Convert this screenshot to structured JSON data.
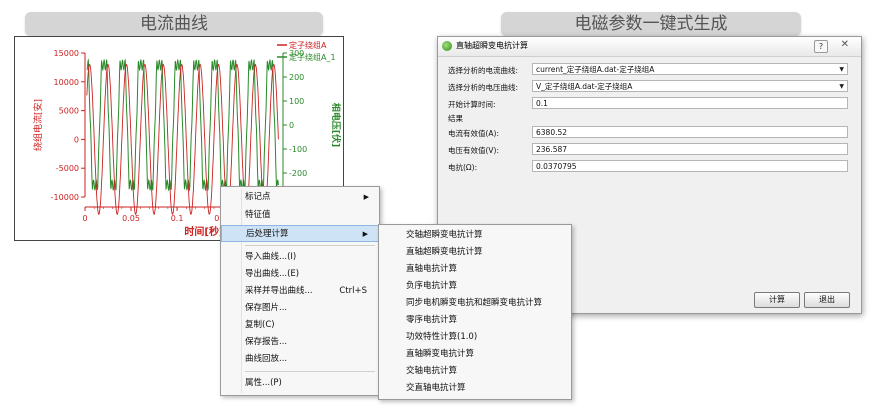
{
  "sections": {
    "left_title": "电流曲线",
    "right_title": "电磁参数一键式生成"
  },
  "chart_data": {
    "type": "line",
    "xlabel": "时间[秒]",
    "ylabel_left": "绕组电流[安]",
    "ylabel_right": "相电压[伏]",
    "x_ticks": [
      "0",
      "0.05",
      "0.1",
      "0.15",
      "0.2"
    ],
    "y_left_ticks": [
      "15000",
      "10000",
      "5000",
      "0",
      "-5000",
      "-10000"
    ],
    "y_right_ticks": [
      "300",
      "200",
      "100",
      "0",
      "-100",
      "-200",
      "-300"
    ],
    "xlim": [
      0,
      0.2
    ],
    "ylim_left": [
      -10000,
      15000
    ],
    "ylim_right": [
      -300,
      300
    ],
    "legend_position": "top-right",
    "series": [
      {
        "name": "定子绕组A",
        "axis": "left",
        "color": "#cc2222",
        "amplitude": 13000,
        "frequency_hz": 50,
        "description": "sinusoid"
      },
      {
        "name": "定子绕组A_1",
        "axis": "right",
        "color": "#2a8a2a",
        "amplitude": 250,
        "frequency_hz": 50,
        "description": "clipped square-like wave"
      }
    ]
  },
  "context_menu": {
    "items": [
      {
        "label": "标记点",
        "has_submenu": true
      },
      {
        "label": "特征值",
        "has_submenu": false
      },
      {
        "label": "后处理计算",
        "has_submenu": true,
        "highlighted": true
      },
      {
        "label": "导入曲线...(I)",
        "has_submenu": false
      },
      {
        "label": "导出曲线...(E)",
        "has_submenu": false
      },
      {
        "label": "采样并导出曲线...",
        "shortcut": "Ctrl+S",
        "has_submenu": false
      },
      {
        "label": "保存图片...",
        "has_submenu": false
      },
      {
        "label": "复制(C)",
        "has_submenu": false
      },
      {
        "label": "保存报告...",
        "has_submenu": false
      },
      {
        "label": "曲线回放...",
        "has_submenu": false
      },
      {
        "label": "属性...(P)",
        "has_submenu": false
      }
    ]
  },
  "submenu": {
    "items": [
      "交轴超瞬变电抗计算",
      "直轴超瞬变电抗计算",
      "直轴电抗计算",
      "负序电抗计算",
      "同步电机瞬变电抗和超瞬变电抗计算",
      "零序电抗计算",
      "功效特性计算(1.0)",
      "直轴瞬变电抗计算",
      "交轴电抗计算",
      "交直轴电抗计算"
    ]
  },
  "dialog": {
    "title": "直轴超瞬变电抗计算",
    "current_curve_label": "选择分析的电流曲线:",
    "current_curve_value": "current_定子绕组A.dat-定子绕组A",
    "voltage_curve_label": "选择分析的电压曲线:",
    "voltage_curve_value": "V_定子绕组A.dat-定子绕组A",
    "start_time_label": "开始计算时间:",
    "start_time_value": "0.1",
    "results_label": "结果",
    "current_rms_label": "电流有效值(A):",
    "current_rms_value": "6380.52",
    "voltage_rms_label": "电压有效值(V):",
    "voltage_rms_value": "236.587",
    "reactance_label": "电抗(Ω):",
    "reactance_value": "0.0370795",
    "compute_button": "计算",
    "exit_button": "退出",
    "help_button": "?",
    "close_button": "✕"
  }
}
